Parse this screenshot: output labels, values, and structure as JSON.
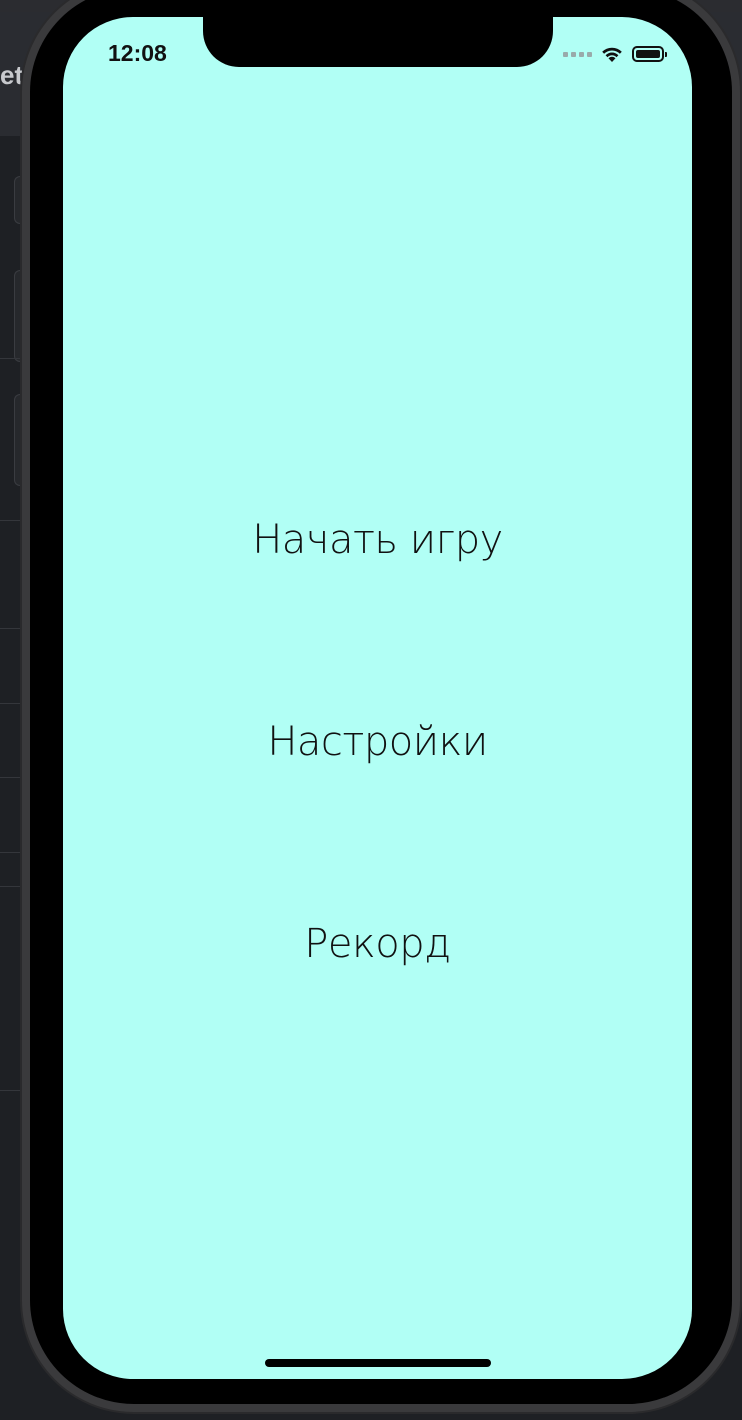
{
  "backdrop": {
    "left_fragment": "et"
  },
  "status_bar": {
    "time": "12:08",
    "icons": [
      "cellular-signal-icon",
      "wifi-icon",
      "battery-icon"
    ]
  },
  "menu": {
    "items": [
      {
        "label": "Начать игру"
      },
      {
        "label": "Настройки"
      },
      {
        "label": "Рекорд"
      }
    ]
  },
  "colors": {
    "screen_background": "#b1fff5",
    "text": "#111111",
    "device_frame": "#3a3a3c"
  }
}
